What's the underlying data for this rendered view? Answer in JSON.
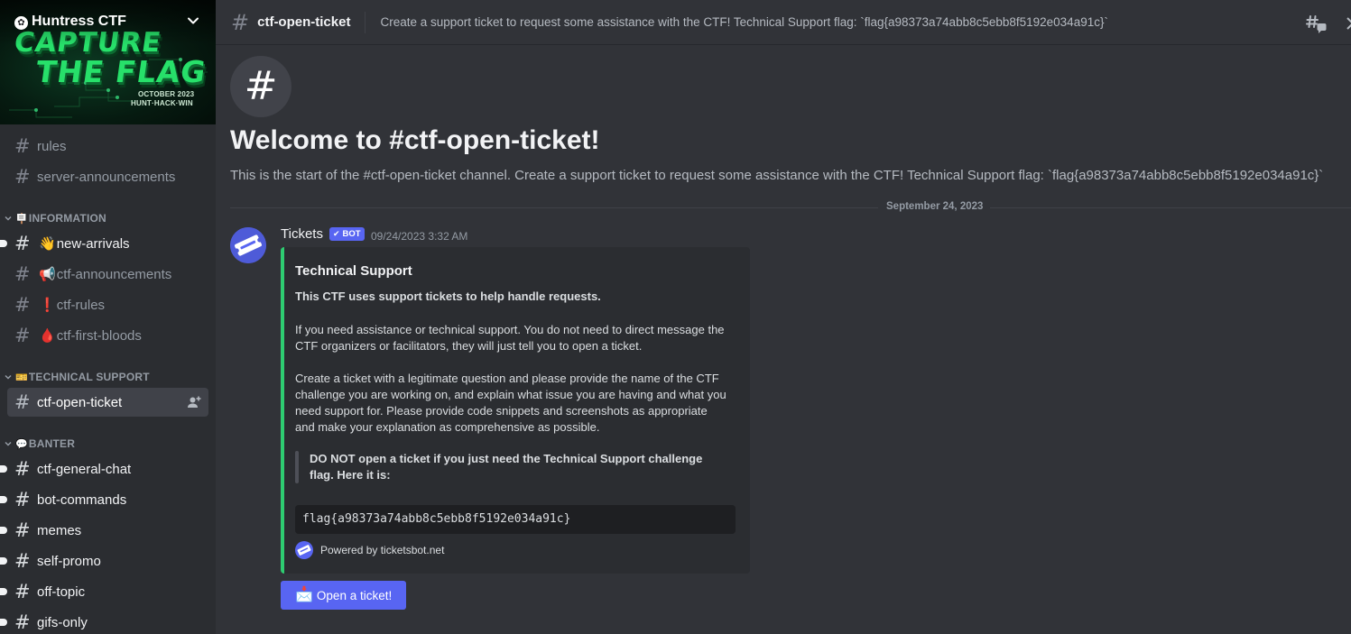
{
  "server": {
    "name": "Huntress CTF",
    "banner": {
      "line1": "CAPTURE",
      "line2": "THE FLAG",
      "date": "OCTOBER 2023",
      "tagline": "HUNT·HACK·WIN"
    }
  },
  "sidebar": {
    "top_channels": [
      {
        "name": "rules",
        "icon": "hash-icon"
      },
      {
        "name": "server-announcements",
        "icon": "hash-icon"
      }
    ],
    "categories": [
      {
        "label": "INFORMATION",
        "emoji": "🪧",
        "channels": [
          {
            "name": "new-arrivals",
            "emoji": "👋",
            "unread": true
          },
          {
            "name": "ctf-announcements",
            "emoji": "📢",
            "unread": false
          },
          {
            "name": "ctf-rules",
            "emoji": "❗",
            "unread": false
          },
          {
            "name": "ctf-first-bloods",
            "emoji": "🩸",
            "unread": false
          }
        ]
      },
      {
        "label": "TECHNICAL SUPPORT",
        "emoji": "🎫",
        "channels": [
          {
            "name": "ctf-open-ticket",
            "selected": true,
            "action_icon": "add-member-icon"
          }
        ]
      },
      {
        "label": "BANTER",
        "emoji": "💬",
        "channels": [
          {
            "name": "ctf-general-chat",
            "unread": true
          },
          {
            "name": "bot-commands",
            "unread": true
          },
          {
            "name": "memes",
            "unread": true
          },
          {
            "name": "self-promo",
            "unread": true
          },
          {
            "name": "off-topic",
            "unread": true
          },
          {
            "name": "gifs-only",
            "unread": true
          }
        ]
      }
    ]
  },
  "header": {
    "channel_name": "ctf-open-ticket",
    "topic": "Create a support ticket to request some assistance with the CTF! Technical Support flag: `flag{a98373a74abb8c5ebb8f5192e034a91c}`",
    "icons": [
      "threads-icon",
      "pin-icon"
    ]
  },
  "welcome": {
    "title": "Welcome to #ctf-open-ticket!",
    "subtitle": "This is the start of the #ctf-open-ticket channel. Create a support ticket to request some assistance with the CTF! Technical Support flag: `flag{a98373a74abb8c5ebb8f5192e034a91c}`"
  },
  "date_divider": "September 24, 2023",
  "message": {
    "author": "Tickets",
    "bot_tag": "BOT",
    "timestamp": "09/24/2023 3:32 AM",
    "embed": {
      "color": "#2ecc71",
      "title": "Technical Support",
      "description_bold": "This CTF uses support tickets to help handle requests.",
      "paragraph1": "If you need assistance or technical support. You do not need to direct message the CTF organizers or facilitators, they will just tell you to open a ticket.",
      "paragraph2": "Create a ticket with a legitimate question and please provide the name of the CTF challenge you are working on, and explain what issue you are having and what you need support for. Please provide code snippets and screenshots as appropriate and make your explanation as comprehensive as possible.",
      "quote": "DO NOT open a ticket if you just need the Technical Support challenge flag. Here it is:",
      "code": "flag{a98373a74abb8c5ebb8f5192e034a91c}",
      "footer": "Powered by ticketsbot.net"
    },
    "button": {
      "emoji": "📩",
      "label": "Open a ticket!",
      "color": "#5865f2"
    }
  }
}
